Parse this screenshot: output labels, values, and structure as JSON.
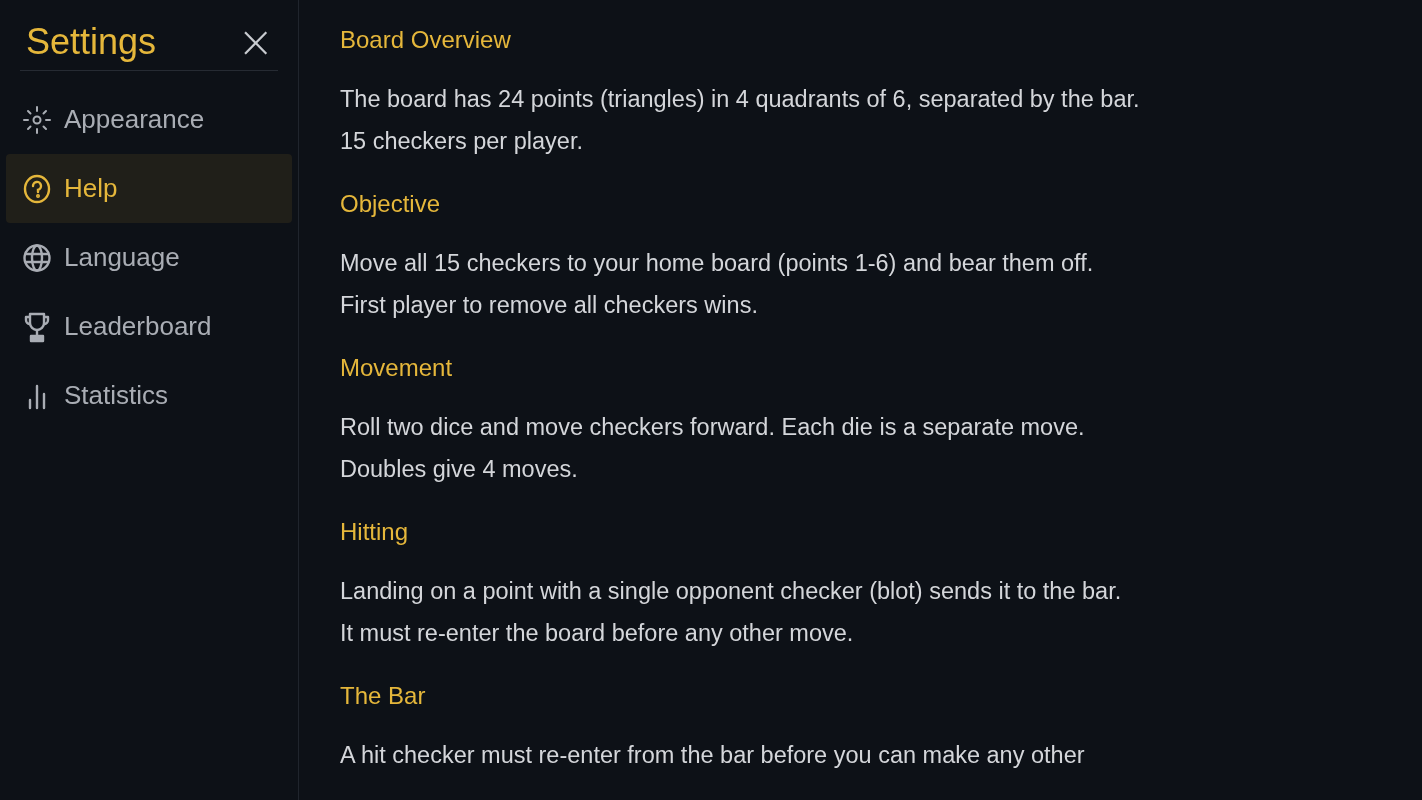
{
  "sidebar": {
    "title": "Settings",
    "close": "×",
    "items": [
      {
        "kind": "appearance",
        "label": "Appearance",
        "selected": false
      },
      {
        "kind": "help",
        "label": "Help",
        "selected": true
      },
      {
        "kind": "language",
        "label": "Language",
        "selected": false
      },
      {
        "kind": "leaderboard",
        "label": "Leaderboard",
        "selected": false
      },
      {
        "kind": "statistics",
        "label": "Statistics",
        "selected": false
      }
    ]
  },
  "sections": [
    {
      "heading": "Board Overview",
      "lines": [
        "The board has 24 points (triangles) in 4 quadrants of 6, separated by the bar.",
        "15 checkers per player."
      ]
    },
    {
      "heading": "Objective",
      "lines": [
        "Move all 15 checkers to your home board (points 1-6) and bear them off.",
        "First player to remove all checkers wins."
      ]
    },
    {
      "heading": "Movement",
      "lines": [
        "Roll two dice and move checkers forward. Each die is a separate move.",
        "Doubles give 4 moves."
      ]
    },
    {
      "heading": "Hitting",
      "lines": [
        "Landing on a point with a single opponent checker (blot) sends it to the bar.",
        "It must re-enter the board before any other move."
      ]
    },
    {
      "heading": "The Bar",
      "lines": [
        "A hit checker must re-enter from the bar before you can make any other"
      ]
    }
  ]
}
